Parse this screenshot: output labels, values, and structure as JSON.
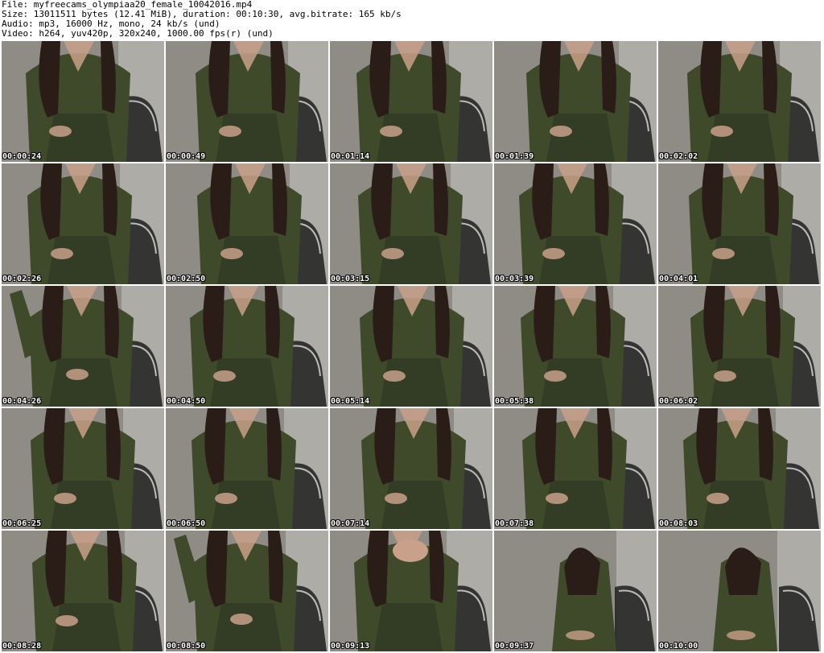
{
  "header": {
    "file_line": "File: myfreecams_olympiaa20_female_10042016.mp4",
    "size_line": "Size: 13011511 bytes (12.41 MiB), duration: 00:10:30, avg.bitrate: 165 kb/s",
    "audio_line": "Audio: mp3, 16000 Hz, mono, 24 kb/s (und)",
    "video_line": "Video: h264, yuv420p, 320x240, 1000.00 fps(r) (und)"
  },
  "thumbnails": [
    {
      "timestamp": "00:00:24",
      "variant": "seated"
    },
    {
      "timestamp": "00:00:49",
      "variant": "seated"
    },
    {
      "timestamp": "00:01:14",
      "variant": "seated"
    },
    {
      "timestamp": "00:01:39",
      "variant": "seated"
    },
    {
      "timestamp": "00:02:02",
      "variant": "seated"
    },
    {
      "timestamp": "00:02:26",
      "variant": "seated"
    },
    {
      "timestamp": "00:02:50",
      "variant": "seated"
    },
    {
      "timestamp": "00:03:15",
      "variant": "seated"
    },
    {
      "timestamp": "00:03:39",
      "variant": "seated"
    },
    {
      "timestamp": "00:04:01",
      "variant": "seated"
    },
    {
      "timestamp": "00:04:26",
      "variant": "arm-raised"
    },
    {
      "timestamp": "00:04:50",
      "variant": "seated"
    },
    {
      "timestamp": "00:05:14",
      "variant": "seated"
    },
    {
      "timestamp": "00:05:38",
      "variant": "seated"
    },
    {
      "timestamp": "00:06:02",
      "variant": "seated"
    },
    {
      "timestamp": "00:06:25",
      "variant": "seated"
    },
    {
      "timestamp": "00:06:50",
      "variant": "seated"
    },
    {
      "timestamp": "00:07:14",
      "variant": "seated"
    },
    {
      "timestamp": "00:07:38",
      "variant": "seated"
    },
    {
      "timestamp": "00:08:03",
      "variant": "seated"
    },
    {
      "timestamp": "00:08:28",
      "variant": "seated"
    },
    {
      "timestamp": "00:08:50",
      "variant": "arm-raised"
    },
    {
      "timestamp": "00:09:13",
      "variant": "hands-face"
    },
    {
      "timestamp": "00:09:37",
      "variant": "far"
    },
    {
      "timestamp": "00:10:00",
      "variant": "far"
    }
  ],
  "colors": {
    "wall": "#8f8c86",
    "wall_light": "#c9c7c2",
    "dress": "#3f4a2b",
    "dress_dark": "#2c3420",
    "hair": "#2a1c16",
    "skin": "#c9a08a",
    "chair": "#1e1e1e",
    "timestamp_text": "#ffffff"
  }
}
